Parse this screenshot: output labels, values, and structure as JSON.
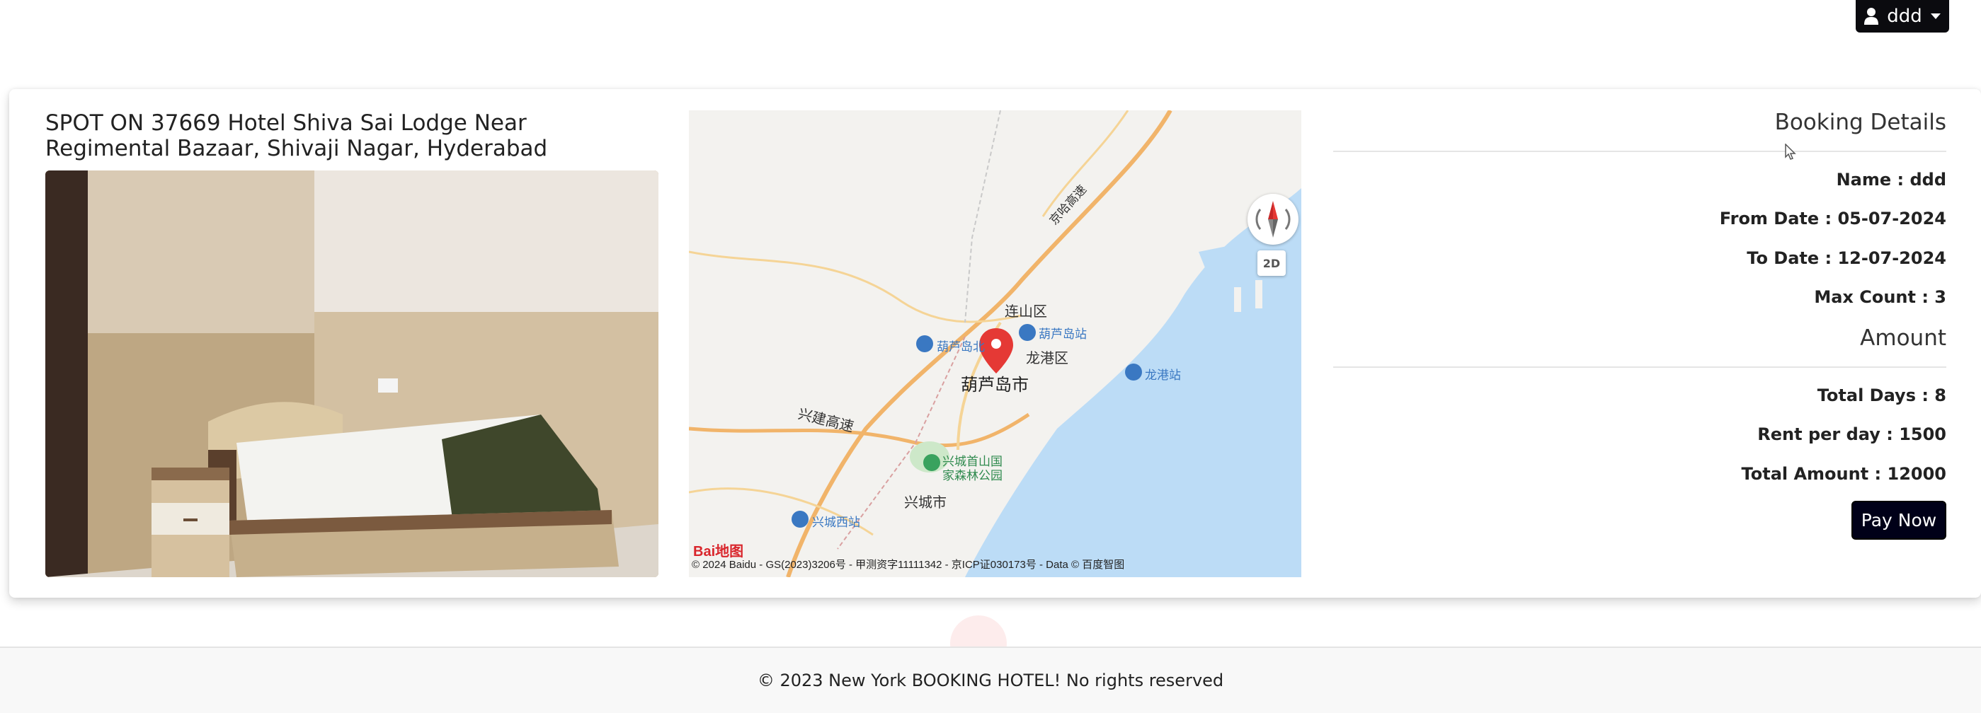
{
  "user_menu": {
    "icon": "user-icon",
    "username": "ddd"
  },
  "hotel": {
    "title": "SPOT ON 37669 Hotel Shiva Sai Lodge Near Regimental Bazaar, Shivaji Nagar, Hyderabad"
  },
  "map": {
    "labels": {
      "lianshan": "连山区",
      "huludao_station": "葫芦岛站",
      "huludao_north": "葫芦岛北",
      "longgang": "龙港区",
      "huludao_city": "葫芦岛市",
      "longgang_station": "龙港站",
      "xingjian_highway": "兴建高速",
      "forest_park_1": "兴城首山国",
      "forest_park_2": "家森林公园",
      "xingcheng_city": "兴城市",
      "xingcheng_west": "兴城西站",
      "highway_jinghai": "京哈高速"
    },
    "mode_button": "2D",
    "logo": "Bai地图",
    "copyright": "© 2024 Baidu - GS(2023)3206号 - 甲测资字11111342 - 京ICP证030173号 - Data © 百度智图"
  },
  "booking": {
    "heading": "Booking Details",
    "name": "Name : ddd",
    "from_date": "From Date : 05-07-2024",
    "to_date": "To Date : 12-07-2024",
    "max_count": "Max Count : 3"
  },
  "amount": {
    "heading": "Amount",
    "total_days": "Total Days : 8",
    "rent_per_day": "Rent per day : 1500",
    "total_amount": "Total Amount : 12000",
    "pay_button": "Pay Now"
  },
  "footer": {
    "text": "© 2023 New York BOOKING HOTEL! No rights reserved"
  },
  "colors": {
    "primary_button": "#000018",
    "map_water": "#bcdcf6",
    "marker": "#e53935"
  }
}
